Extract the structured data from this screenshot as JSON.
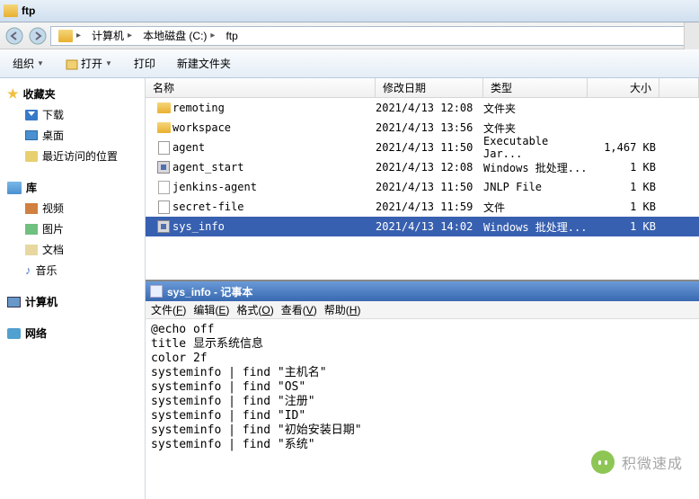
{
  "window": {
    "title": "ftp"
  },
  "breadcrumb": {
    "items": [
      "计算机",
      "本地磁盘 (C:)",
      "ftp"
    ]
  },
  "toolbar": {
    "org": "组织",
    "open": "打开",
    "print": "打印",
    "newfolder": "新建文件夹"
  },
  "sidebar": {
    "fav": {
      "title": "收藏夹",
      "download": "下载",
      "desktop": "桌面",
      "recent": "最近访问的位置"
    },
    "lib": {
      "title": "库",
      "video": "视频",
      "picture": "图片",
      "doc": "文档",
      "music": "音乐"
    },
    "computer": "计算机",
    "network": "网络"
  },
  "columns": {
    "name": "名称",
    "date": "修改日期",
    "type": "类型",
    "size": "大小"
  },
  "files": [
    {
      "icon": "folder",
      "name": "remoting",
      "date": "2021/4/13 12:08",
      "type": "文件夹",
      "size": ""
    },
    {
      "icon": "folder",
      "name": "workspace",
      "date": "2021/4/13 13:56",
      "type": "文件夹",
      "size": ""
    },
    {
      "icon": "jar",
      "name": "agent",
      "date": "2021/4/13 11:50",
      "type": "Executable Jar...",
      "size": "1,467 KB"
    },
    {
      "icon": "bat",
      "name": "agent_start",
      "date": "2021/4/13 12:08",
      "type": "Windows 批处理...",
      "size": "1 KB"
    },
    {
      "icon": "jnlp",
      "name": "jenkins-agent",
      "date": "2021/4/13 11:50",
      "type": "JNLP File",
      "size": "1 KB"
    },
    {
      "icon": "txt",
      "name": "secret-file",
      "date": "2021/4/13 11:59",
      "type": "文件",
      "size": "1 KB"
    },
    {
      "icon": "bat",
      "name": "sys_info",
      "date": "2021/4/13 14:02",
      "type": "Windows 批处理...",
      "size": "1 KB",
      "selected": true
    }
  ],
  "notepad": {
    "title": "sys_info - 记事本",
    "menu": {
      "file": "文件",
      "file_hk": "F",
      "edit": "编辑",
      "edit_hk": "E",
      "format": "格式",
      "format_hk": "O",
      "view": "查看",
      "view_hk": "V",
      "help": "帮助",
      "help_hk": "H"
    },
    "content": "@echo off\ntitle 显示系统信息\ncolor 2f\nsysteminfo | find \"主机名\"\nsysteminfo | find \"OS\"\nsysteminfo | find \"注册\"\nsysteminfo | find \"ID\"\nsysteminfo | find \"初始安装日期\"\nsysteminfo | find \"系统\""
  },
  "watermark": "积微速成"
}
